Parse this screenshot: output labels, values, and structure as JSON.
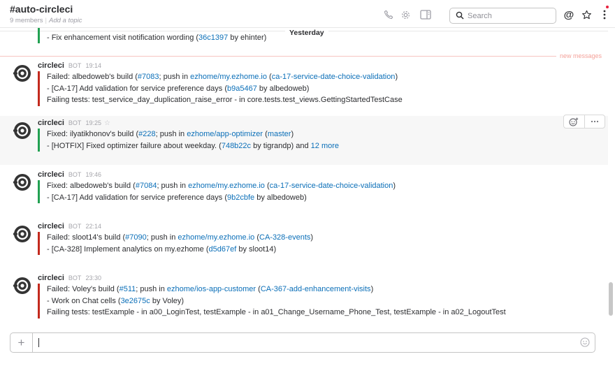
{
  "channel": {
    "title": "#auto-circleci",
    "members": "9 members",
    "topic": "Add a topic"
  },
  "header": {
    "icons": [
      "phone-icon",
      "gear-icon",
      "sidebar-toggle-icon",
      "search-icon",
      "at-mention-icon",
      "star-icon",
      "more-vertical-icon"
    ],
    "search_placeholder": "Search"
  },
  "feed": {
    "day_label": "Yesterday",
    "new_messages_label": "new messages",
    "previous": {
      "pre": "- Fix enhancement visit notification wording (",
      "commit": "36c1397",
      "post": " by ehinter)"
    },
    "messages": [
      {
        "author": "circleci",
        "badge": "BOT",
        "time": "19:14",
        "status": "failed",
        "build": {
          "prefix": "Failed:  albedoweb's build (",
          "num": "#7083",
          "mid": "; push in ",
          "repo": "ezhome/my.ezhome.io",
          "branch": "ca-17-service-date-choice-validation"
        },
        "commit": {
          "pre": "- [CA-17] Add validation for service preference days (",
          "sha": "b9a5467",
          "post": " by albedoweb)"
        },
        "failing": "Failing tests: test_service_day_duplication_raise_error - in core.tests.test_views.GettingStartedTestCase"
      },
      {
        "author": "circleci",
        "badge": "BOT",
        "time": "19:25",
        "status": "fixed",
        "build": {
          "prefix": "Fixed:  ilyatikhonov's build (",
          "num": "#228",
          "mid": "; push in ",
          "repo": "ezhome/app-optimizer",
          "branch": "master"
        },
        "commit": {
          "pre": "- [HOTFIX] Fixed optimizer failure about weekday. (",
          "sha": "748b22c",
          "post": " by tigrandp) and ",
          "more": "12 more"
        }
      },
      {
        "author": "circleci",
        "badge": "BOT",
        "time": "19:46",
        "status": "fixed",
        "build": {
          "prefix": "Fixed:  albedoweb's build (",
          "num": "#7084",
          "mid": "; push in ",
          "repo": "ezhome/my.ezhome.io",
          "branch": "ca-17-service-date-choice-validation"
        },
        "commit": {
          "pre": "- [CA-17] Add validation for service preference days (",
          "sha": "9b2cbfe",
          "post": " by albedoweb)"
        }
      },
      {
        "author": "circleci",
        "badge": "BOT",
        "time": "22:14",
        "status": "failed",
        "build": {
          "prefix": "Failed:  sloot14's build (",
          "num": "#7090",
          "mid": "; push in ",
          "repo": "ezhome/my.ezhome.io",
          "branch": "CA-328-events"
        },
        "commit": {
          "pre": "- [CA-328] Implement analytics on my.ezhome (",
          "sha": "d5d67ef",
          "post": " by sloot14)"
        }
      },
      {
        "author": "circleci",
        "badge": "BOT",
        "time": "23:30",
        "status": "failed",
        "build": {
          "prefix": "Failed:  Voley's build (",
          "num": "#511",
          "mid": "; push in ",
          "repo": "ezhome/ios-app-customer",
          "branch": "CA-367-add-enhancement-visits"
        },
        "commit": {
          "pre": "- Work on Chat cells (",
          "sha": "3e2675c",
          "post": " by Voley)"
        },
        "failing": "Failing tests: testExample - in a00_LoginTest, testExample - in a01_Change_Username_Phone_Test, testExample - in a02_LogoutTest"
      }
    ]
  },
  "composer": {
    "value": "",
    "icons": [
      "plus-icon",
      "emoji-icon"
    ]
  },
  "colors": {
    "failed": "#c32a1e",
    "fixed": "#22a152",
    "link": "#0b6fb8",
    "new_messages": "#f4a29a"
  }
}
